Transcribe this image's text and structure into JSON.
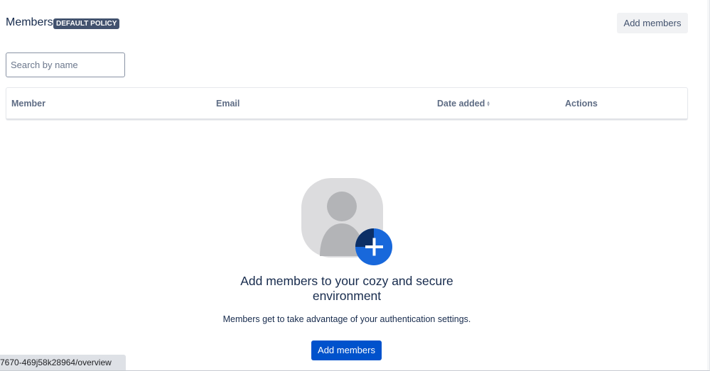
{
  "header": {
    "title": "Members",
    "policy_badge": "DEFAULT POLICY",
    "add_button_label": "Add members"
  },
  "search": {
    "placeholder": "Search by name",
    "value": ""
  },
  "table": {
    "columns": [
      {
        "label": "Member",
        "sortable": false
      },
      {
        "label": "Email",
        "sortable": false
      },
      {
        "label": "Date added",
        "sortable": true
      },
      {
        "label": "Actions",
        "sortable": false
      }
    ],
    "rows": []
  },
  "empty_state": {
    "illustration_icon": "add-user-icon",
    "title": "Add members to your cozy and secure environment",
    "description": "Members get to take advantage of your authentication settings.",
    "button_label": "Add members"
  },
  "status_bar": {
    "url_text": "7670-469j58k28964/overview"
  },
  "colors": {
    "primary": "#0052cc",
    "badge_bg": "#42526e",
    "heading": "#172b4d",
    "subtle_text": "#5e6c84",
    "illustration_blue": "#1868db",
    "illustration_navy": "#0c2f66"
  }
}
